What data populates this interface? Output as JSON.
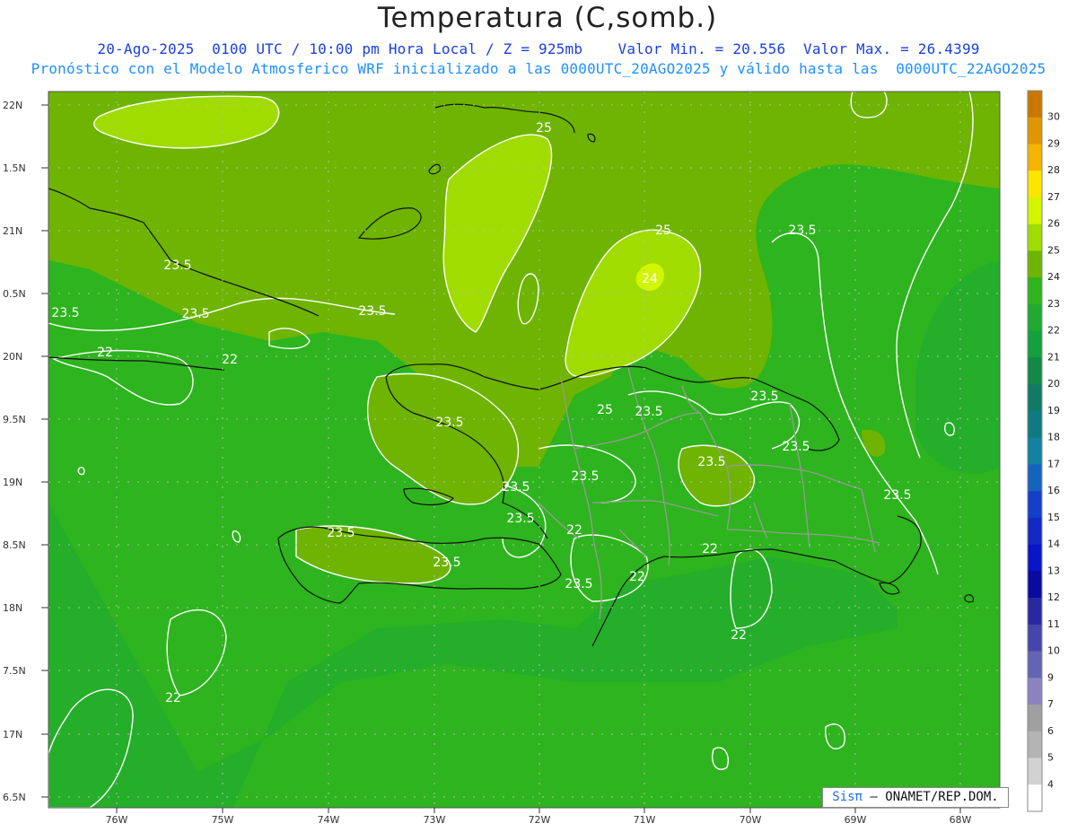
{
  "header": {
    "title": "Temperatura (C,somb.)",
    "line1": "20-Ago-2025  0100 UTC / 10:00 pm Hora Local / Z = 925mb    Valor Min. = 20.556  Valor Max. = 26.4399",
    "line2": "Pronóstico con el Modelo Atmosferico WRF inicializado a las 0000UTC_20AGO2025 y válido hasta las  0000UTC_22AGO2025"
  },
  "axes": {
    "lat_labels": [
      "22N",
      "1.5N",
      "21N",
      "0.5N",
      "20N",
      "9.5N",
      "19N",
      "8.5N",
      "18N",
      "7.5N",
      "17N",
      "6.5N"
    ],
    "lon_labels": [
      "76W",
      "75W",
      "74W",
      "73W",
      "72W",
      "71W",
      "70W",
      "69W",
      "68W"
    ]
  },
  "contour_labels": [
    "25",
    "25",
    "25",
    "23.5",
    "23.5",
    "23.5",
    "23.5",
    "23.5",
    "23.5",
    "23.5",
    "23.5",
    "23.5",
    "23.5",
    "23.5",
    "23.5",
    "23.5",
    "22",
    "22",
    "22",
    "22",
    "22",
    "22",
    "24"
  ],
  "colorbar": {
    "labels": [
      "30",
      "29",
      "28",
      "27",
      "26",
      "25",
      "24",
      "23",
      "22",
      "21",
      "20",
      "19",
      "18",
      "17",
      "16",
      "15",
      "14",
      "13",
      "12",
      "11",
      "10",
      "9",
      "7",
      "6",
      "5",
      "4"
    ],
    "colors": [
      "#c87800",
      "#e09600",
      "#f5b400",
      "#fae600",
      "#d2f500",
      "#a0dc00",
      "#6eb400",
      "#2eb41e",
      "#20aa32",
      "#14a03c",
      "#128a46",
      "#117a64",
      "#0f7a82",
      "#1282a0",
      "#1464be",
      "#1440c8",
      "#1428c8",
      "#0a14c8",
      "#0a0aa0",
      "#2828a0",
      "#4646aa",
      "#6464b4",
      "#8c82be",
      "#a0a0a0",
      "#b4b4b4",
      "#d2d2d2",
      "#ffffff"
    ]
  },
  "credit": {
    "logo": "Sisπ",
    "text": "– ONAMET/REP.DOM."
  }
}
